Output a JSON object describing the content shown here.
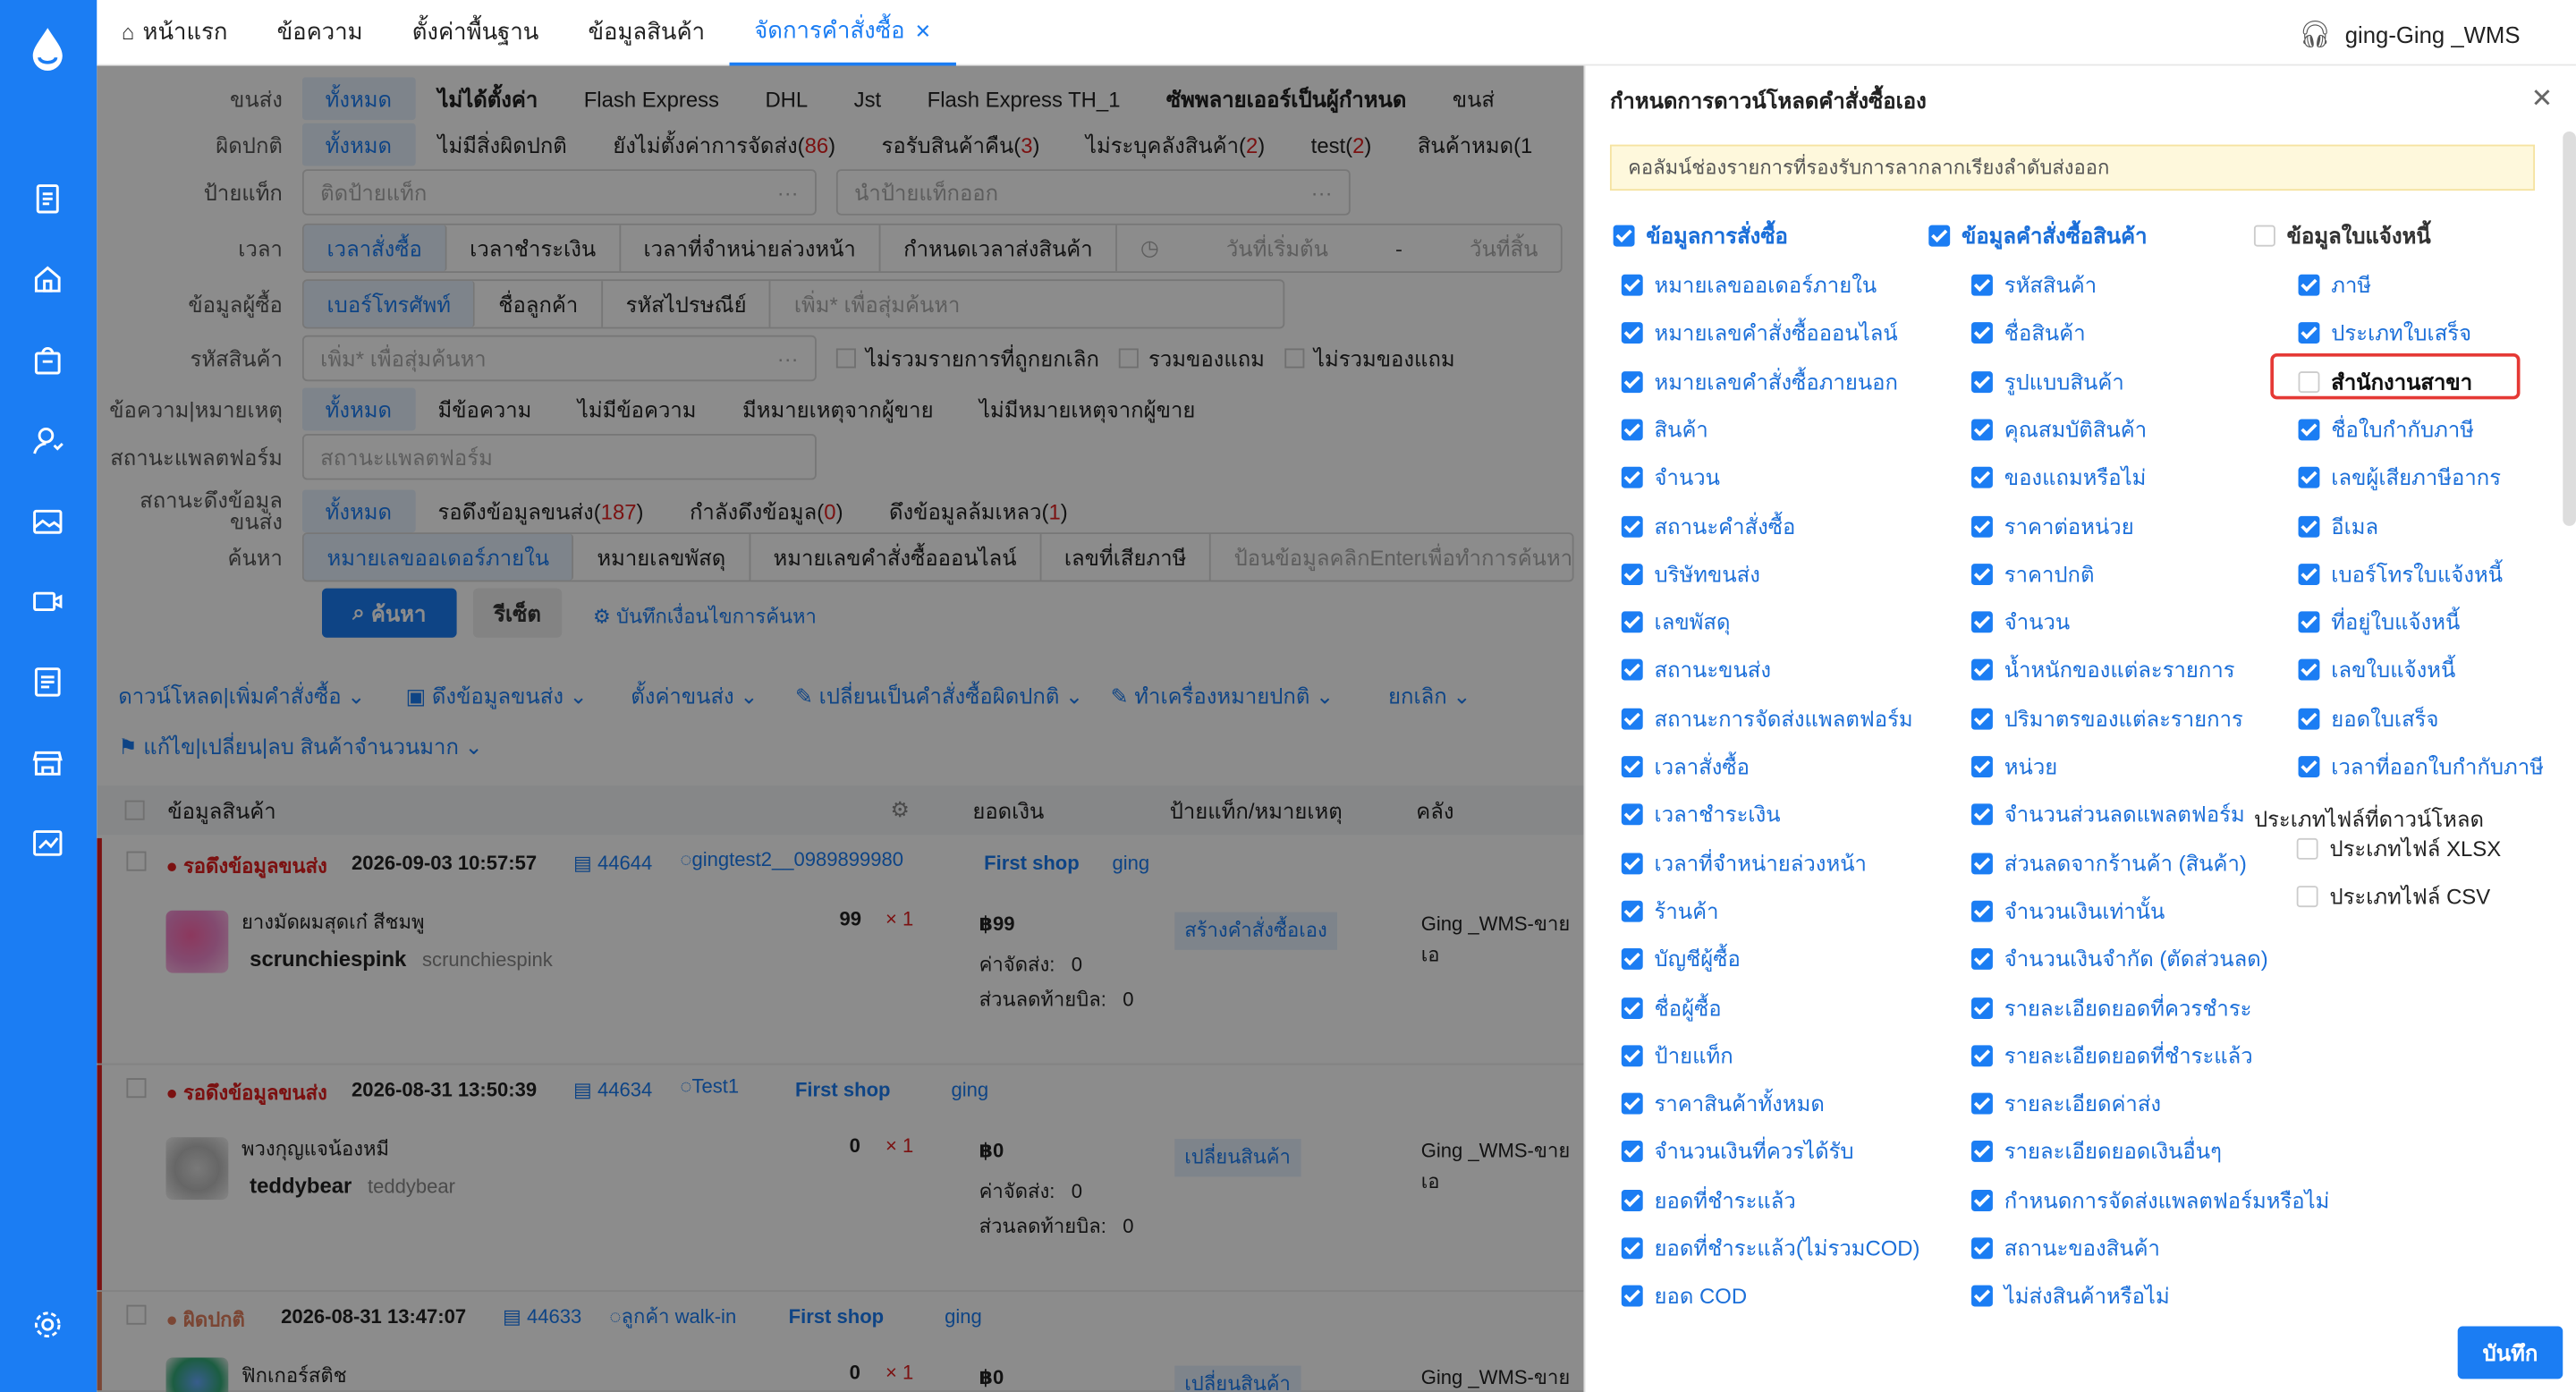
{
  "colors": {
    "brand": "#1b7df3",
    "danger": "#e02020",
    "highlight": "#e53935"
  },
  "sidebar": {
    "icons": [
      "logo-drop-icon",
      "document-icon",
      "home-icon",
      "bag-icon",
      "user-icon",
      "image-icon",
      "video-icon",
      "report-icon",
      "store-icon",
      "chart-icon",
      "settings-icon"
    ]
  },
  "tabs": [
    {
      "label": "หน้าแรก"
    },
    {
      "label": "ข้อความ"
    },
    {
      "label": "ตั้งค่าพื้นฐาน"
    },
    {
      "label": "ข้อมูลสินค้า"
    },
    {
      "label": "จัดการคำสั่งซื้อ"
    }
  ],
  "user": {
    "name": "ging-Ging _WMS"
  },
  "filters": {
    "shipping": {
      "label": "ขนส่ง",
      "options": [
        "ทั้งหมด",
        "ไม่ได้ตั้งค่า",
        "Flash Express",
        "DHL",
        "Jst",
        "Flash Express TH_1",
        "ซัพพลายเออร์เป็นผู้กำหนด",
        "ขนส่"
      ]
    },
    "abnormal": {
      "label": "ผิดปกติ",
      "options": [
        "ทั้งหมด",
        "ไม่มีสิ่งผิดปกติ",
        "ยังไม่ตั้งค่าการจัดส่ง(",
        "รอรับสินค้าคืน(",
        "ไม่ระบุคลังสินค้า(",
        "test(",
        "สินค้าหมด(1"
      ],
      "counts": [
        "",
        "",
        "86",
        "3",
        "2",
        "2",
        ""
      ]
    },
    "tag": {
      "label": "ป้ายแท็ก",
      "ph1": "ติดป้ายแท็ก",
      "ph2": "นำป้ายแท็กออก"
    },
    "time": {
      "label": "เวลา",
      "options": [
        "เวลาสั่งซื้อ",
        "เวลาชำระเงิน",
        "เวลาที่จำหน่ายล่วงหน้า",
        "กำหนดเวลาส่งสินค้า"
      ],
      "start": "วันที่เริ่มต้น",
      "dash": "-",
      "end": "วันที่สิ้น"
    },
    "buyer": {
      "label": "ข้อมูลผู้ซื้อ",
      "options": [
        "เบอร์โทรศัพท์",
        "ชื่อลูกค้า",
        "รหัสไปรษณีย์"
      ],
      "ph": "เพิ่ม* เพื่อสุ่มค้นหา"
    },
    "sku": {
      "label": "รหัสสินค้า",
      "ph": "เพิ่ม* เพื่อสุ่มค้นหา",
      "checks": [
        "ไม่รวมรายการที่ถูกยกเลิก",
        "รวมของแถม",
        "ไม่รวมของแถม"
      ]
    },
    "memo": {
      "label": "ข้อความ|หมายเหตุ",
      "options": [
        "ทั้งหมด",
        "มีข้อความ",
        "ไม่มีข้อความ",
        "มีหมายเหตุจากผู้ขาย",
        "ไม่มีหมายเหตุจากผู้ขาย"
      ]
    },
    "platform": {
      "label": "สถานะแพลตฟอร์ม",
      "ph": "สถานะแพลตฟอร์ม"
    },
    "pull": {
      "label1": "สถานะดึงข้อมูล",
      "label2": "ขนส่ง",
      "options": [
        "ทั้งหมด",
        "รอดึงข้อมูลขนส่ง(",
        "กำลังดึงข้อมูล(",
        "ดึงข้อมูลล้มเหลว("
      ],
      "counts": [
        "",
        "187",
        "0",
        "1"
      ]
    },
    "search": {
      "label": "ค้นหา",
      "options": [
        "หมายเลขออเดอร์ภายใน",
        "หมายเลขพัสดุ",
        "หมายเลขคำสั่งซื้อออนไลน์",
        "เลขที่เสียภาษี"
      ],
      "ph": "ป้อนข้อมูลคลิกEnterเพื่อทำการค้นหา"
    }
  },
  "buttons": {
    "search": "ค้นหา",
    "reset": "รีเซ็ต",
    "save_cond": "บันทึกเงื่อนไขการค้นหา"
  },
  "actions": [
    "ดาวน์โหลด|เพิ่มคำสั่งซื้อ",
    "ดึงข้อมูลขนส่ง",
    "ตั้งค่าขนส่ง",
    "เปลี่ยนเป็นคำสั่งซื้อผิดปกติ",
    "ทำเครื่องหมายปกติ",
    "ยกเลิก"
  ],
  "actions2": "แก้ไข|เปลี่ยน|ลบ สินค้าจำนวนมาก",
  "table": {
    "headers": [
      "ข้อมูลสินค้า",
      "ยอดเงิน",
      "ป้ายแท็ก/หมายเหตุ",
      "คลัง"
    ]
  },
  "orders": [
    {
      "status": "รอดึงข้อมูลขนส่ง",
      "time": "2026-09-03 10:57:57",
      "id": "44644",
      "buyer": "gingtest2__0989899980",
      "shop": "First shop",
      "owner": "ging",
      "name": "ยางมัดผมสุดเก๋ สีชมพู",
      "sku": "scrunchiespink",
      "sku2": "scrunchiespink",
      "qty": "99",
      "mult": "× 1",
      "price": "฿99",
      "ship_label": "ค่าจัดส่ง:",
      "ship": "0",
      "disc_label": "ส่วนลดท้ายบิล:",
      "disc": "0",
      "tag": "สร้างคำสั่งซื้อเอง",
      "wh": "Ging _WMS-ขายเอ"
    },
    {
      "status": "รอดึงข้อมูลขนส่ง",
      "time": "2026-08-31 13:50:39",
      "id": "44634",
      "buyer": "Test1",
      "shop": "First shop",
      "owner": "ging",
      "name": "พวงกุญแจน้องหมี",
      "sku": "teddybear",
      "sku2": "teddybear",
      "qty": "0",
      "mult": "× 1",
      "price": "฿0",
      "ship_label": "ค่าจัดส่ง:",
      "ship": "0",
      "disc_label": "ส่วนลดท้ายบิล:",
      "disc": "0",
      "tag": "เปลี่ยนสินค้า",
      "wh": "Ging _WMS-ขายเอ"
    },
    {
      "status": "ผิดปกติ",
      "time": "2026-08-31 13:47:07",
      "id": "44633",
      "buyer": "ลูกค้า walk-in",
      "shop": "First shop",
      "owner": "ging",
      "name": "ฟิกเกอร์สติช",
      "qty": "0",
      "mult": "× 1",
      "price": "฿0",
      "tag": "เปลี่ยนสินค้า",
      "wh": "Ging _WMS-ขายเอ"
    }
  ],
  "panel": {
    "title": "กำหนดการดาวน์โหลดคำสั่งซื้อเอง",
    "tip": "คอลัมน์ช่องรายการที่รองรับการลากลากเรียงลำดับส่งออก",
    "col1": {
      "header": "ข้อมูลการสั่งซื้อ",
      "items": [
        "หมายเลขออเดอร์ภายใน",
        "หมายเลขคำสั่งซื้อออนไลน์",
        "หมายเลขคำสั่งซื้อภายนอก",
        "สินค้า",
        "จำนวน",
        "สถานะคำสั่งซื้อ",
        "บริษัทขนส่ง",
        "เลขพัสดุ",
        "สถานะขนส่ง",
        "สถานะการจัดส่งแพลตฟอร์ม",
        "เวลาสั่งซื้อ",
        "เวลาชำระเงิน",
        "เวลาที่จำหน่ายล่วงหน้า",
        "ร้านค้า",
        "บัญชีผู้ซื้อ",
        "ชื่อผู้ซื้อ",
        "ป้ายแท็ก",
        "ราคาสินค้าทั้งหมด",
        "จำนวนเงินที่ควรได้รับ",
        "ยอดที่ชำระแล้ว",
        "ยอดที่ชำระแล้ว(ไม่รวมCOD)",
        "ยอด COD"
      ]
    },
    "col2": {
      "header": "ข้อมูลคำสั่งซื้อสินค้า",
      "items": [
        "รหัสสินค้า",
        "ชื่อสินค้า",
        "รูปแบบสินค้า",
        "คุณสมบัติสินค้า",
        "ของแถมหรือไม่",
        "ราคาต่อหน่วย",
        "ราคาปกติ",
        "จำนวน",
        "น้ำหนักของแต่ละรายการ",
        "ปริมาตรของแต่ละรายการ",
        "หน่วย",
        "จำนวนส่วนลดแพลตฟอร์ม",
        "ส่วนลดจากร้านค้า (สินค้า)",
        "จำนวนเงินเท่านั้น",
        "จำนวนเงินจำกัด (ตัดส่วนลด)",
        "รายละเอียดยอดที่ควรชำระ",
        "รายละเอียดยอดที่ชำระแล้ว",
        "รายละเอียดค่าส่ง",
        "รายละเอียดยอดเงินอื่นๆ",
        "กำหนดการจัดส่งแพลตฟอร์มหรือไม่",
        "สถานะของสินค้า",
        "ไม่ส่งสินค้าหรือไม่"
      ]
    },
    "col3": {
      "header": "ข้อมูลใบแจ้งหนี้",
      "items": [
        {
          "label": "ภาษี",
          "on": true
        },
        {
          "label": "ประเภทใบเสร็จ",
          "on": true
        },
        {
          "label": "สำนักงานสาขา",
          "on": false
        },
        {
          "label": "ชื่อใบกำกับภาษี",
          "on": true
        },
        {
          "label": "เลขผู้เสียภาษีอากร",
          "on": true
        },
        {
          "label": "อีเมล",
          "on": true
        },
        {
          "label": "เบอร์โทรใบแจ้งหนี้",
          "on": true
        },
        {
          "label": "ที่อยู่ใบแจ้งหนี้",
          "on": true
        },
        {
          "label": "เลขใบแจ้งหนี้",
          "on": true
        },
        {
          "label": "ยอดใบเสร็จ",
          "on": true
        },
        {
          "label": "เวลาที่ออกใบกำกับภาษี",
          "on": true
        }
      ]
    },
    "filetype": {
      "label": "ประเภทไฟล์ที่ดาวน์โหลด",
      "options": [
        "ประเภทไฟล์ XLSX",
        "ประเภทไฟล์ CSV"
      ]
    },
    "save": "บันทึก"
  }
}
